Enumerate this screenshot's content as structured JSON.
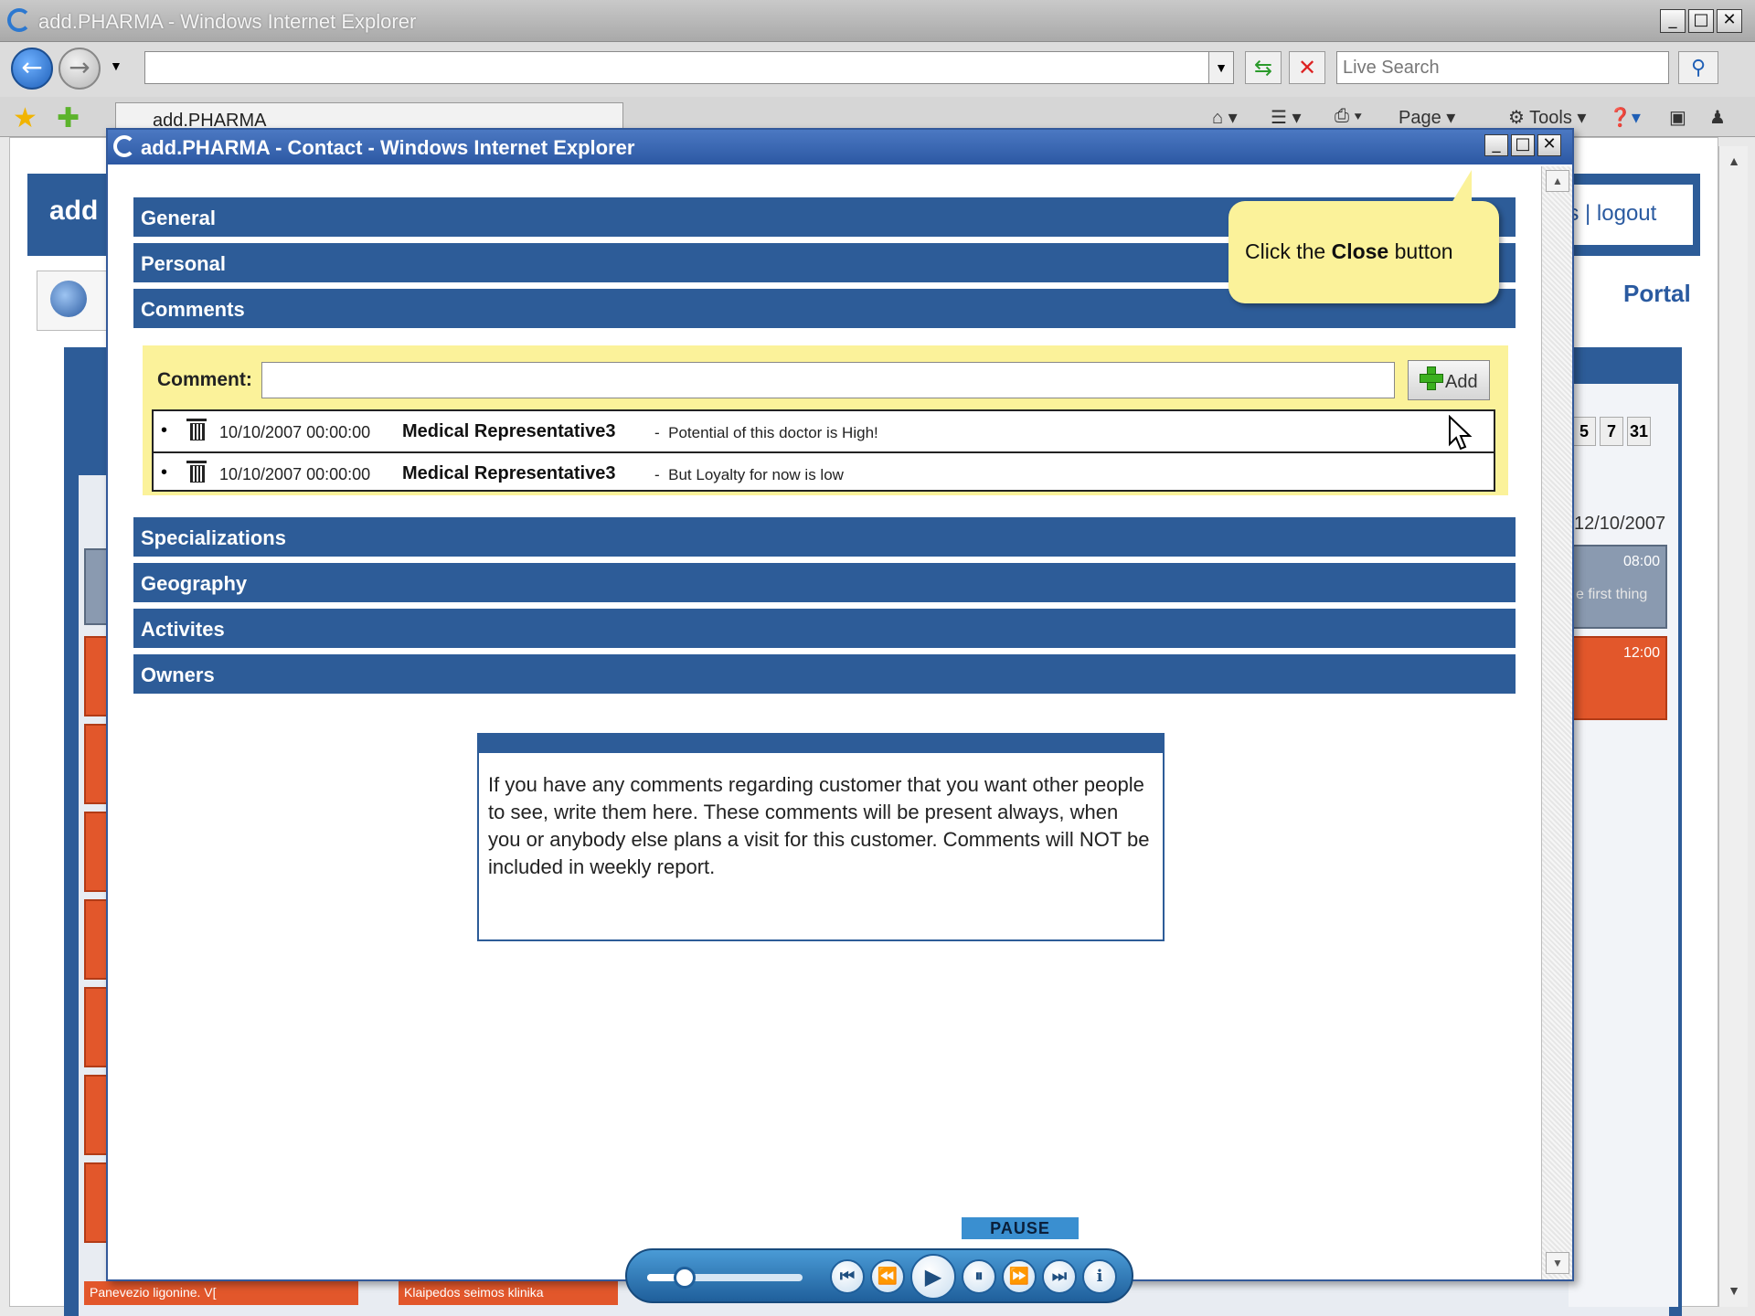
{
  "browser": {
    "title": "add.PHARMA - Windows Internet Explorer",
    "search_placeholder": "Live Search",
    "tab_label": "add.PHARMA",
    "commands": {
      "page": "Page",
      "tools": "Tools"
    }
  },
  "background_page": {
    "brand": "add",
    "links": "gs | logout",
    "portal": "Portal",
    "calendar_buttons": [
      "5",
      "7",
      "31"
    ],
    "date": "12/10/2007",
    "event1": {
      "time": "08:00",
      "desc": "e first thing"
    },
    "event2": {
      "time": "12:00"
    },
    "bottom_items": [
      "Panevezio ligonine. V[",
      "Klaipedos seimos klinika"
    ]
  },
  "popup": {
    "title": "add.PHARMA - Contact - Windows Internet Explorer",
    "sections": [
      "General",
      "Personal",
      "Comments",
      "Specializations",
      "Geography",
      "Activites",
      "Owners"
    ],
    "comment_label": "Comment:",
    "add_label": "Add",
    "comments": [
      {
        "date": "10/10/2007 00:00:00",
        "author": "Medical Representative3",
        "separator": "-",
        "text": "Potential of this doctor is High!"
      },
      {
        "date": "10/10/2007 00:00:00",
        "author": "Medical Representative3",
        "separator": "-",
        "text": "But Loyalty for now is low"
      }
    ],
    "help_text": "If you have any comments regarding customer that you want other people to see, write them here. These comments will be present always, when you or anybody else plans a visit for this customer. Comments will NOT be included in weekly report."
  },
  "callout": {
    "prefix": "Click the ",
    "bold": "Close",
    "suffix": " button"
  },
  "player": {
    "pause_label": "PAUSE",
    "progress": 0.24
  }
}
